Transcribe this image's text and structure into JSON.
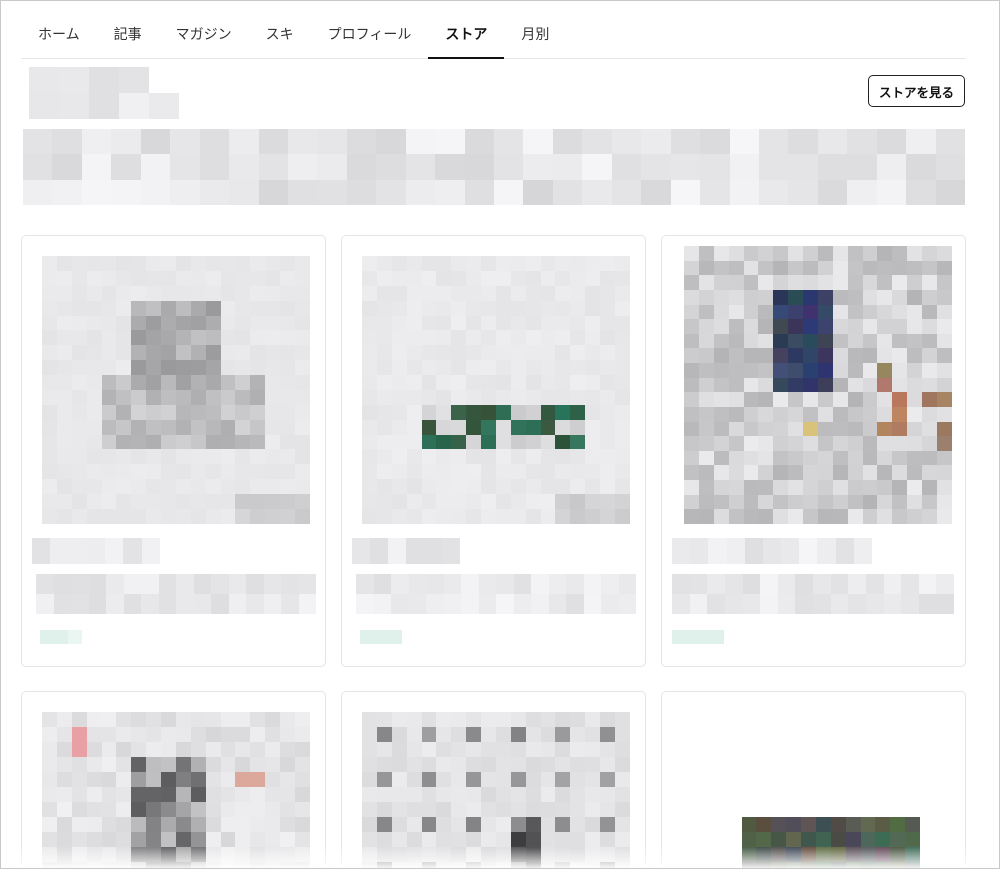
{
  "tabs": [
    {
      "label": "ホーム",
      "active": false
    },
    {
      "label": "記事",
      "active": false
    },
    {
      "label": "マガジン",
      "active": false
    },
    {
      "label": "スキ",
      "active": false
    },
    {
      "label": "プロフィール",
      "active": false
    },
    {
      "label": "ストア",
      "active": true
    },
    {
      "label": "月別",
      "active": false
    }
  ],
  "store": {
    "view_store_label": "ストアを見る"
  },
  "colors": {
    "accent_green": "#2e6b55",
    "tag_green": "#dff1ea",
    "border": "#e4e4e4"
  }
}
